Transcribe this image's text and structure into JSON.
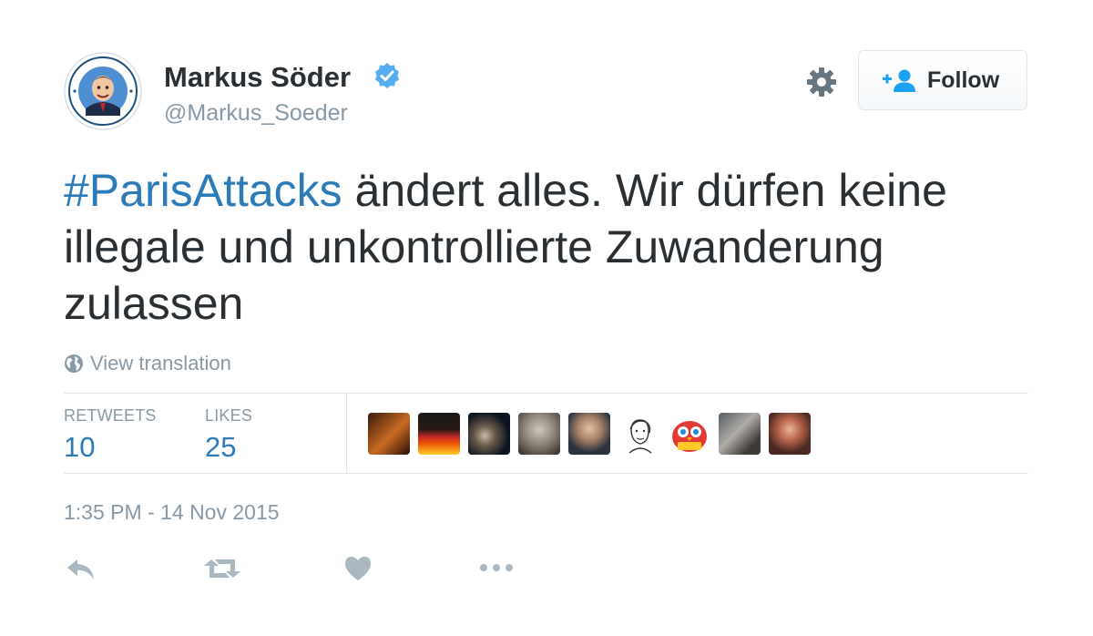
{
  "user": {
    "display_name": "Markus Söder",
    "handle": "@Markus_Soeder",
    "verified": true,
    "avatar_badge_text": "Markus Söder für Nürnberg"
  },
  "header": {
    "settings_icon": "gear-icon",
    "follow_label": "Follow",
    "follow_icon": "add-user-icon"
  },
  "tweet": {
    "hashtag": "#ParisAttacks",
    "text": " ändert alles. Wir dürfen keine illegale und unkontrollierte Zuwanderung zulassen"
  },
  "translation": {
    "label": "View translation",
    "icon": "globe-icon"
  },
  "stats": {
    "retweets_label": "RETWEETS",
    "retweets_count": "10",
    "likes_label": "LIKES",
    "likes_count": "25"
  },
  "likers_count_shown": 9,
  "timestamp": "1:35 PM - 14 Nov 2015",
  "actions": [
    "reply-icon",
    "retweet-icon",
    "like-icon",
    "more-icon"
  ],
  "colors": {
    "link": "#2b7bb9",
    "text": "#292f33",
    "muted": "#8899a6",
    "verified": "#55acee",
    "border": "#e1e8ed",
    "icon": "#aab8c2"
  }
}
